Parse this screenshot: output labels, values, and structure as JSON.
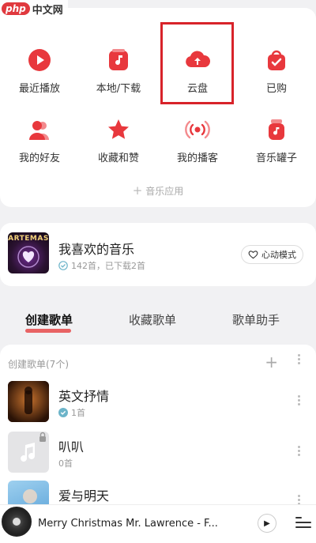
{
  "watermark": {
    "logo": "php",
    "text": "中文网"
  },
  "quick_grid": {
    "items": [
      {
        "label": "最近播放",
        "icon": "play-icon"
      },
      {
        "label": "本地/下载",
        "icon": "music-note-icon"
      },
      {
        "label": "云盘",
        "icon": "cloud-upload-icon"
      },
      {
        "label": "已购",
        "icon": "bag-check-icon"
      },
      {
        "label": "我的好友",
        "icon": "friends-icon"
      },
      {
        "label": "收藏和赞",
        "icon": "star-icon"
      },
      {
        "label": "我的播客",
        "icon": "broadcast-icon"
      },
      {
        "label": "音乐罐子",
        "icon": "music-jar-icon"
      }
    ],
    "music_apps_label": "音乐应用"
  },
  "favorites": {
    "title": "我喜欢的音乐",
    "subtitle": "142首，已下载2首",
    "mode_button": "心动模式",
    "cover_text": "ARTEMAS"
  },
  "tabs": [
    {
      "label": "创建歌单",
      "active": true
    },
    {
      "label": "收藏歌单",
      "active": false
    },
    {
      "label": "歌单助手",
      "active": false
    }
  ],
  "playlists": {
    "header": "创建歌单(7个)",
    "items": [
      {
        "name": "英文抒情",
        "count": "1首",
        "downloaded": true
      },
      {
        "name": "叭叭",
        "count": "0首",
        "downloaded": false
      },
      {
        "name": "爱与明天",
        "count": "",
        "downloaded": false
      }
    ]
  },
  "player": {
    "title": "Merry Christmas Mr. Lawrence - F..."
  },
  "colors": {
    "accent": "#e8383d",
    "highlight_box": "#d8232a"
  }
}
